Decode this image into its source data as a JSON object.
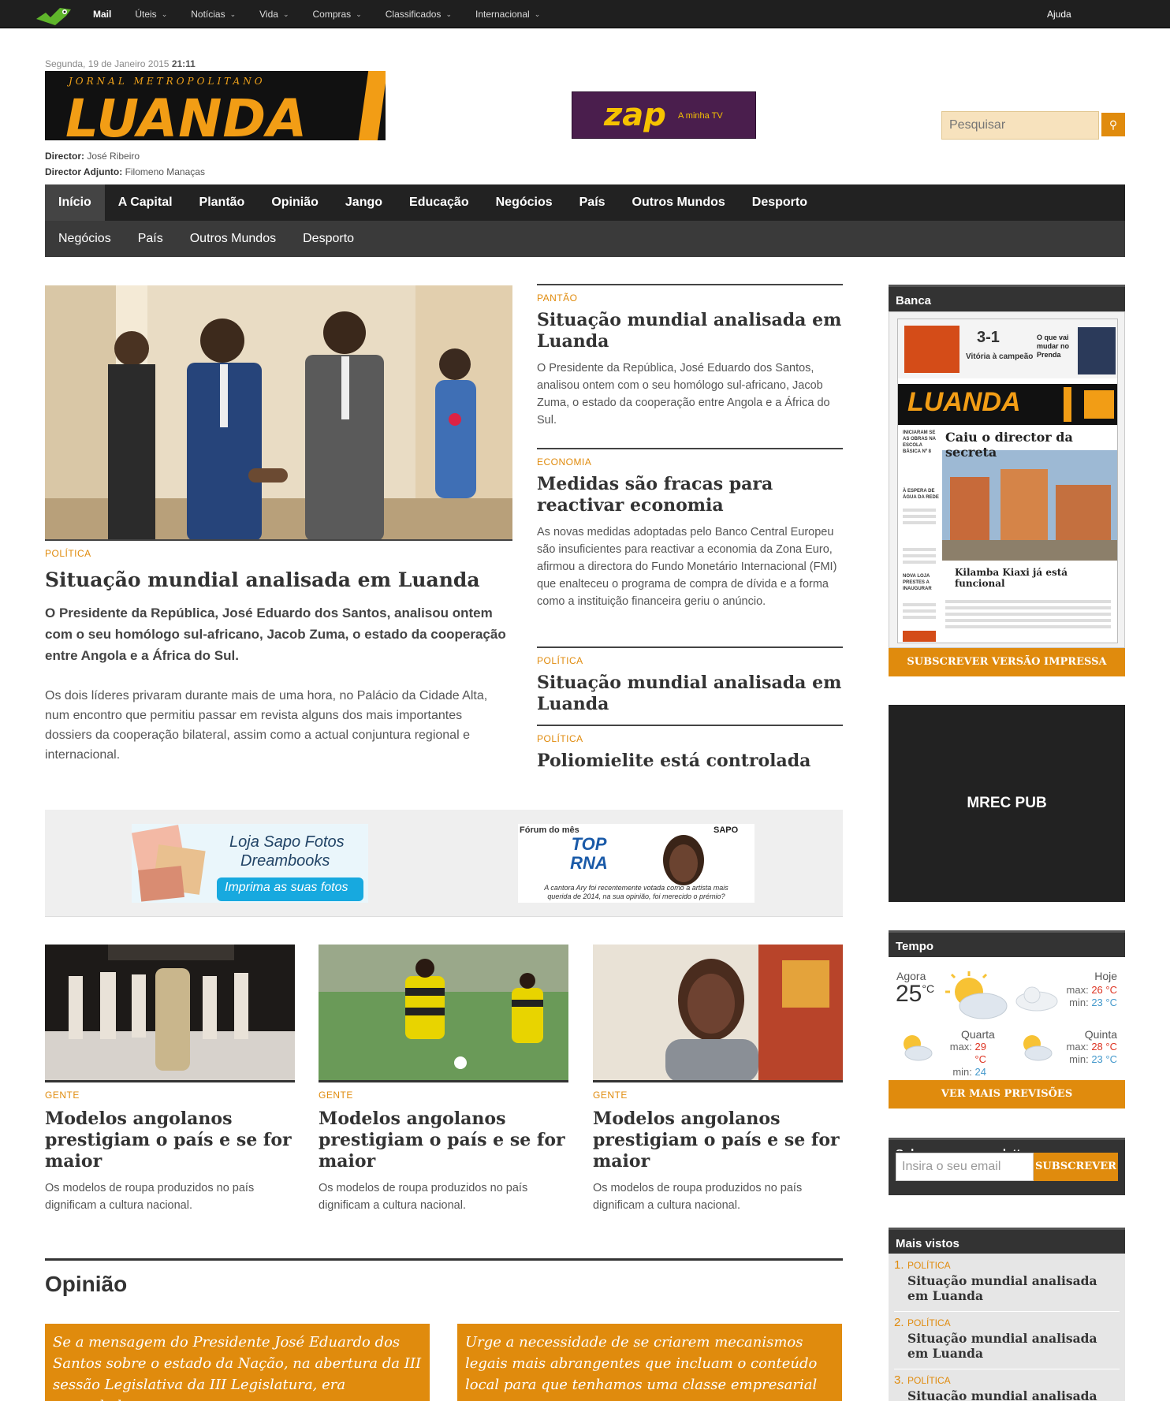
{
  "topbar": {
    "items": [
      {
        "label": "Mail"
      },
      {
        "label": "Úteis"
      },
      {
        "label": "Notícias"
      },
      {
        "label": "Vida"
      },
      {
        "label": "Compras"
      },
      {
        "label": "Classificados"
      },
      {
        "label": "Internacional"
      }
    ],
    "help": "Ajuda"
  },
  "header": {
    "date": "Segunda, 19 de Janeiro 2015",
    "time": "21:11",
    "masthead_sub": "JORNAL METROPOLITANO",
    "masthead_title": "LUANDA",
    "director_label": "Director:",
    "director_name": "José Ribeiro",
    "deputy_label": "Director Adjunto:",
    "deputy_name": "Filomeno Manaças",
    "ad_brand": "zap",
    "ad_tag": "A minha TV",
    "search_placeholder": "Pesquisar"
  },
  "mainnav": [
    "Início",
    "A Capital",
    "Plantão",
    "Opinião",
    "Jango",
    "Educação",
    "Negócios",
    "País",
    "Outros Mundos",
    "Desporto"
  ],
  "subnav": [
    "Negócios",
    "País",
    "Outros Mundos",
    "Desporto"
  ],
  "featured": {
    "category": "POLÍTICA",
    "title": "Situação mundial analisada em Luanda",
    "lead": "O Presidente da República, José Eduardo dos Santos, analisou ontem com o seu homólogo sul-africano, Jacob Zuma, o estado da cooperação entre Angola e a África do Sul.",
    "body": "Os dois líderes privaram durante mais de uma hora, no Palácio da Cidade Alta, num encontro que permitiu passar em revista alguns dos mais importantes dossiers da cooperação bilateral, assim como a actual conjuntura regional e internacional."
  },
  "side_articles": [
    {
      "category": "PANTÃO",
      "title": "Situação mundial analisada em Luanda",
      "text": "O Presidente da República, José Eduardo dos Santos, analisou ontem com o seu homólogo sul-africano, Jacob Zuma, o estado da cooperação entre Angola e a África do Sul."
    },
    {
      "category": "ECONOMIA",
      "title": "Medidas são fracas para reactivar economia",
      "text": "As novas medidas adoptadas pelo Banco Central Europeu são insuficientes para reactivar a economia da Zona Euro, afirmou a directora do Fundo Monetário Internacional (FMI) que enalteceu o programa de compra de dívida e a forma como a instituição financeira geriu o anúncio."
    },
    {
      "category": "POLÍTICA",
      "title": "Situação mundial analisada em Luanda",
      "text": ""
    },
    {
      "category": "POLÍTICA",
      "title": "Poliomielite está controlada",
      "text": ""
    }
  ],
  "ads": {
    "sapo_line1": "Loja Sapo Fotos",
    "sapo_line2": "Dreambooks",
    "sapo_cta": "Imprima as suas fotos",
    "forum_title": "Fórum do mês",
    "forum_logo": "TOP RNA",
    "forum_brand": "SAPO",
    "forum_text": "A cantora Ary foi recentemente votada como a artista mais querida de 2014, na sua opinião, foi merecido o prémio?"
  },
  "cards": [
    {
      "category": "GENTE",
      "title": "Modelos angolanos prestigiam o país e se for maior",
      "text": "Os modelos de roupa produzidos no país dignificam a cultura nacional."
    },
    {
      "category": "GENTE",
      "title": "Modelos angolanos prestigiam o país e se for maior",
      "text": "Os modelos de roupa produzidos no país dignificam a cultura nacional."
    },
    {
      "category": "GENTE",
      "title": "Modelos angolanos prestigiam o país e se for maior",
      "text": "Os modelos de roupa produzidos no país dignificam a cultura nacional."
    }
  ],
  "opiniao": {
    "heading": "Opinião",
    "boxes": [
      {
        "text": "Se a mensagem do Presidente José Eduardo dos Santos sobre o estado da Nação, na abertura da III sessão Legislativa da III Legislatura, era aguardada"
      },
      {
        "text": "Urge a necessidade de se criarem mecanismos legais mais abrangentes que incluam o conteúdo local para que tenhamos uma classe empresarial"
      }
    ]
  },
  "sidebar": {
    "banca": {
      "title": "Banca",
      "cover_score": "3-1",
      "cover_score_caption": "Vitória à campeão",
      "cover_side_headline": "O que vai mudar no Prenda",
      "cover_masthead": "LUANDA",
      "cover_headline": "Caiu o director da secreta",
      "cover_caption": "Kilamba Kiaxi já está funcional",
      "cover_left_1": "INICIARAM SE AS OBRAS NA ESCOLA BÁSICA Nº 8",
      "cover_left_2": "À ESPERA DE ÁGUA DA REDE",
      "cover_left_3": "NOVA LOJA PRESTES A INAUGURAR",
      "subscribe": "SUBSCREVER VERSÃO IMPRESSA"
    },
    "mrec": "MREC PUB",
    "tempo": {
      "title": "Tempo",
      "now_label": "Agora",
      "now_temp": "25",
      "unit": "°C",
      "days": [
        {
          "label": "Hoje",
          "max": "26",
          "min": "23"
        },
        {
          "label": "Quarta",
          "max": "29",
          "min": "24"
        },
        {
          "label": "Quinta",
          "max": "28",
          "min": "23"
        }
      ],
      "max_label": "max:",
      "min_label": "min:",
      "more": "VER MAIS PREVISÕES"
    },
    "newsletter": {
      "title": "Subscrever a newsletter",
      "placeholder": "Insira o seu email",
      "button": "SUBSCREVER"
    },
    "mais_vistos": {
      "title": "Mais vistos",
      "items": [
        {
          "num": "1.",
          "category": "POLÍTICA",
          "title": "Situação mundial analisada em Luanda"
        },
        {
          "num": "2.",
          "category": "POLÍTICA",
          "title": "Situação mundial analisada em Luanda"
        },
        {
          "num": "3.",
          "category": "POLÍTICA",
          "title": "Situação mundial analisada em"
        }
      ]
    }
  }
}
